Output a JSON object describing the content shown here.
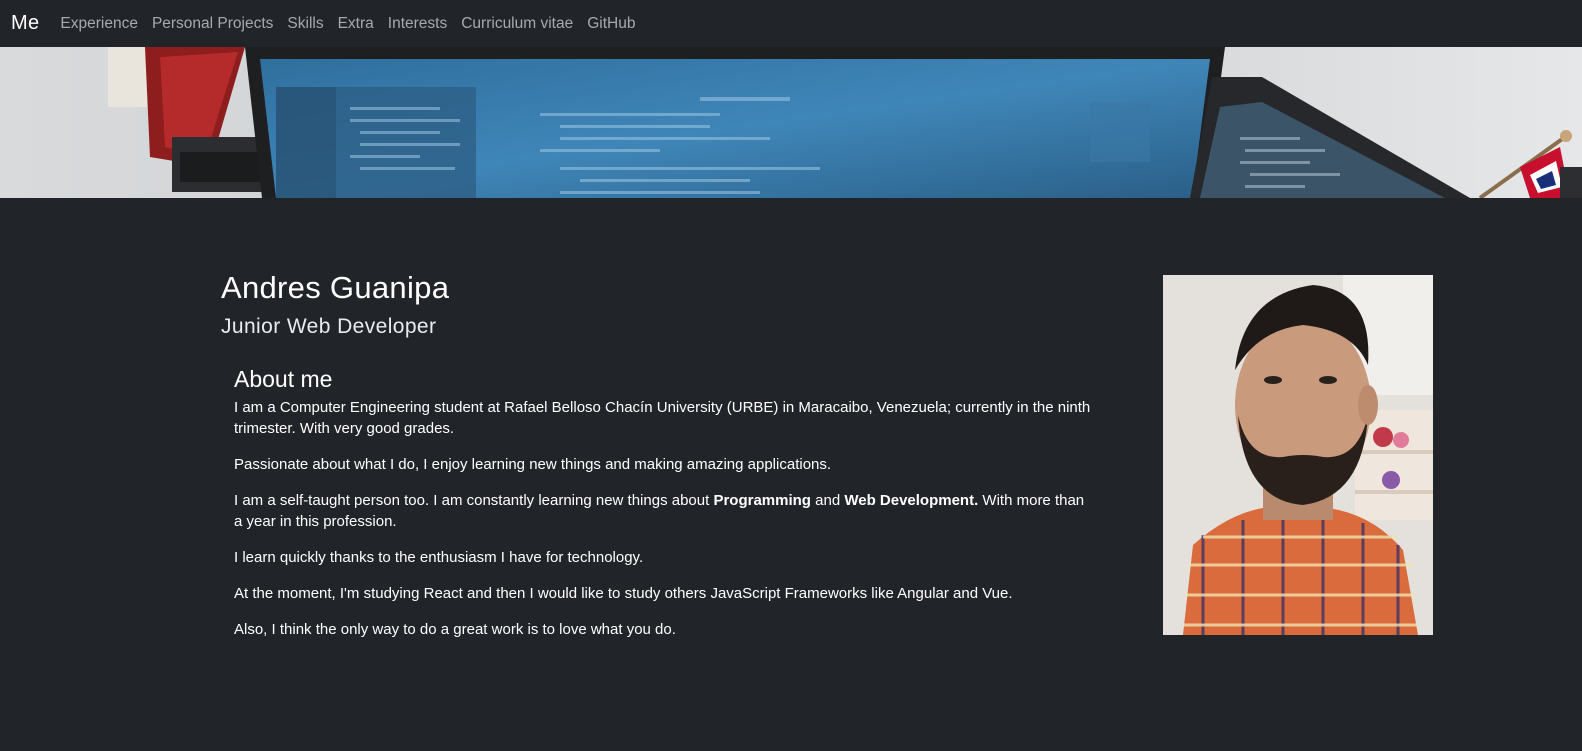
{
  "nav": {
    "brand": "Me",
    "links": [
      {
        "label": "Experience"
      },
      {
        "label": "Personal Projects"
      },
      {
        "label": "Skills"
      },
      {
        "label": "Extra"
      },
      {
        "label": "Interests"
      },
      {
        "label": "Curriculum vitae"
      },
      {
        "label": "GitHub"
      }
    ]
  },
  "profile": {
    "name": "Andres Guanipa",
    "role": "Junior Web Developer"
  },
  "about": {
    "heading": "About me",
    "p1": "I am a Computer Engineering student at Rafael Belloso Chacín University (URBE) in Maracaibo, Venezuela; currently in the ninth trimester. With very good grades.",
    "p2": "Passionate about what I do, I enjoy learning new things and making amazing applications.",
    "p3_start": "I am a self-taught person too. I am constantly learning new things about ",
    "p3_bold1": "Programming",
    "p3_mid": " and ",
    "p3_bold2": "Web Development.",
    "p3_end": " With more than a year in this profession.",
    "p4": "I learn quickly thanks to the enthusiasm I have for technology.",
    "p5": "At the moment, I'm studying React and then I would like to study others JavaScript Frameworks like Angular and Vue.",
    "p6": "Also, I think the only way to do a great work is to love what you do."
  },
  "colors": {
    "background": "#212529",
    "nav_link": "#a7a9ac",
    "text": "#ffffff"
  }
}
